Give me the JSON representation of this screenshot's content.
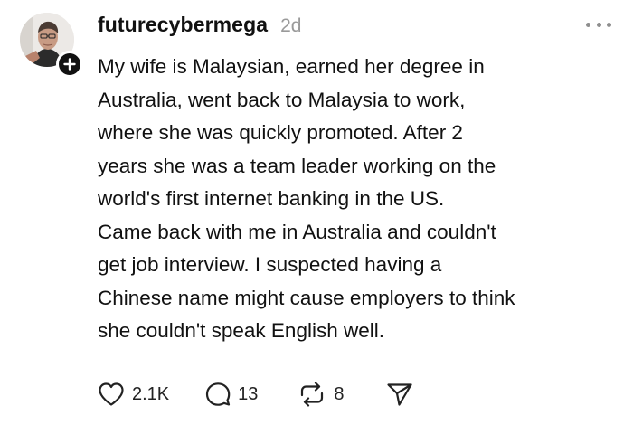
{
  "post": {
    "username": "futurecybermega",
    "timestamp": "2d",
    "body_lines": [
      "My wife is Malaysian, earned her degree in",
      "Australia, went back to Malaysia to work,",
      "where she was quickly promoted. After 2",
      "years she was a team leader working on the",
      "world's first internet banking in the US.",
      "Came back with me in Australia and couldn't",
      "get job interview. I suspected having a",
      "Chinese name might cause employers to think",
      "she couldn't speak English well."
    ],
    "actions": {
      "likes": "2.1K",
      "replies": "13",
      "reposts": "8"
    }
  },
  "icons": {
    "follow": "plus-icon",
    "more": "ellipsis-icon",
    "like": "heart-icon",
    "reply": "speech-bubble-icon",
    "repost": "repost-arrows-icon",
    "share": "paper-plane-icon"
  },
  "colors": {
    "text": "#111111",
    "muted": "#9a9a9a",
    "badge": "#111111"
  }
}
